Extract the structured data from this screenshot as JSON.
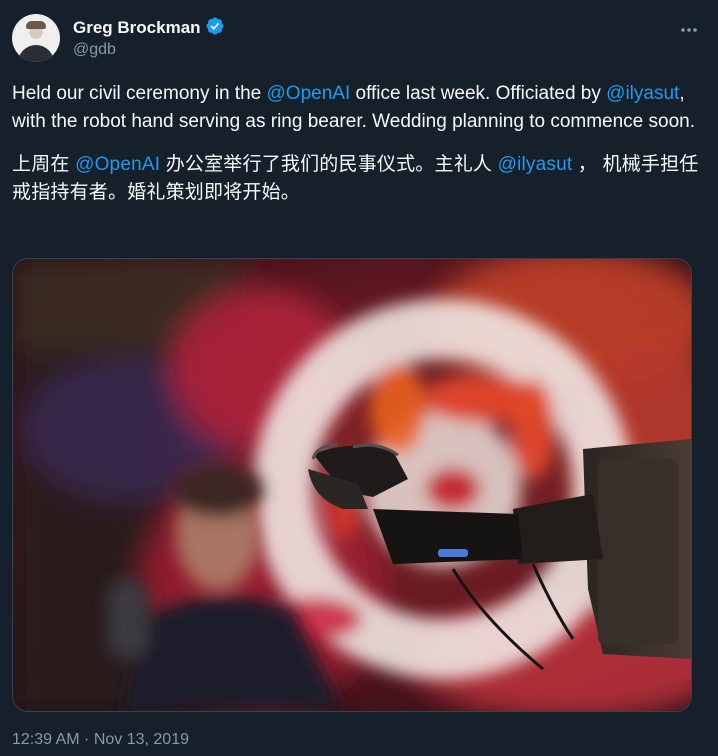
{
  "author": {
    "display_name": "Greg Brockman",
    "handle": "@gdb",
    "verified": true
  },
  "tweet": {
    "en": {
      "p1": "Held our civil ceremony in the ",
      "m1": "@OpenAI",
      "p2": " office last week. Officiated by ",
      "m2": "@ilyasut",
      "p3": ", with the robot hand serving as ring bearer. Wedding planning to commence soon."
    },
    "zh": {
      "p1": "上周在 ",
      "m1": "@OpenAI",
      "p2": " 办公室举行了我们的民事仪式。主礼人 ",
      "m2": "@ilyasut",
      "p3": " ， 机械手担任戒指持有者。婚礼策划即将开始。"
    }
  },
  "timestamp": "12:39 AM · Nov 13, 2019",
  "icons": {
    "verified": "verified-badge-icon",
    "more": "more-options-icon"
  },
  "colors": {
    "background": "#15202b",
    "accent": "#1d9bf0",
    "secondary_text": "#8b98a5"
  }
}
